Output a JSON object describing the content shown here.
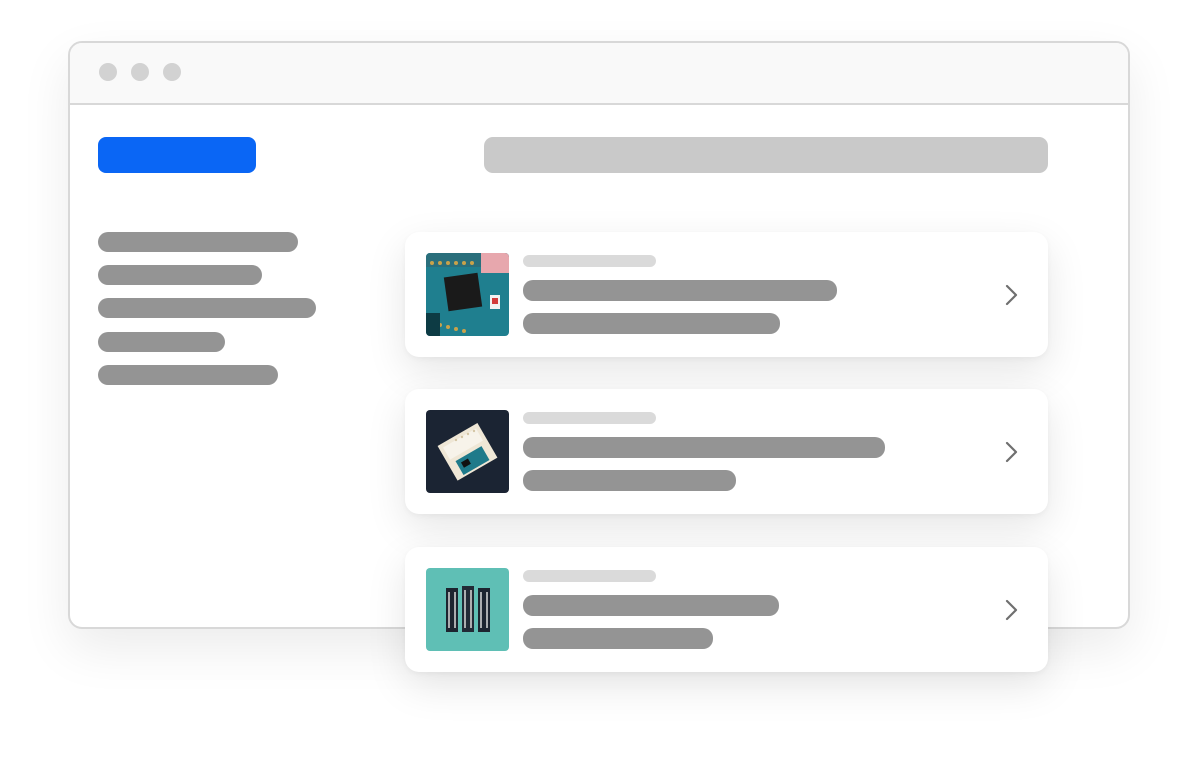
{
  "window": {
    "controls": [
      "close-dot",
      "minimize-dot",
      "maximize-dot"
    ]
  },
  "colors": {
    "accent": "#0a66f5",
    "placeholder_dark": "#949494",
    "placeholder_light": "#dadada",
    "search_bar": "#c9c9c9",
    "dot": "#d2d2d2"
  },
  "sidebar": {
    "items": [
      "",
      "",
      "",
      "",
      ""
    ]
  },
  "cards": [
    {
      "image": "arduino-nano-board-photo",
      "icon": "chevron-right-icon"
    },
    {
      "image": "arduino-uno-breadboard-photo",
      "icon": "chevron-right-icon"
    },
    {
      "image": "three-microcontroller-boards-photo",
      "icon": "chevron-right-icon"
    }
  ]
}
